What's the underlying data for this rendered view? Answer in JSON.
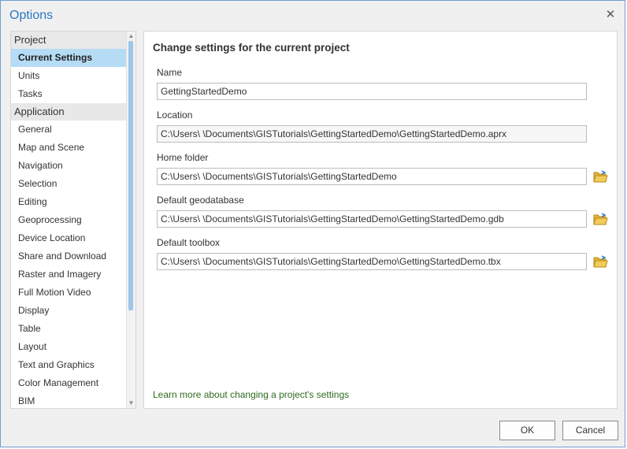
{
  "window": {
    "title": "Options",
    "close_icon": "close-icon"
  },
  "nav": {
    "groups": [
      {
        "header": "Project",
        "items": [
          "Current Settings",
          "Units",
          "Tasks"
        ]
      },
      {
        "header": "Application",
        "items": [
          "General",
          "Map and Scene",
          "Navigation",
          "Selection",
          "Editing",
          "Geoprocessing",
          "Device Location",
          "Share and Download",
          "Raster and Imagery",
          "Full Motion Video",
          "Display",
          "Table",
          "Layout",
          "Text and Graphics",
          "Color Management",
          "BIM"
        ]
      }
    ],
    "selected": "Current Settings"
  },
  "content": {
    "heading": "Change settings for the current project",
    "fields": {
      "name": {
        "label": "Name",
        "value": "GettingStartedDemo"
      },
      "location": {
        "label": "Location",
        "value": "C:\\Users\\            \\Documents\\GISTutorials\\GettingStartedDemo\\GettingStartedDemo.aprx"
      },
      "home_folder": {
        "label": "Home folder",
        "value": "C:\\Users\\            \\Documents\\GISTutorials\\GettingStartedDemo"
      },
      "default_geodatabase": {
        "label": "Default geodatabase",
        "value": "C:\\Users\\            \\Documents\\GISTutorials\\GettingStartedDemo\\GettingStartedDemo.gdb"
      },
      "default_toolbox": {
        "label": "Default toolbox",
        "value": "C:\\Users\\            \\Documents\\GISTutorials\\GettingStartedDemo\\GettingStartedDemo.tbx"
      }
    },
    "learn_more": "Learn more about changing a project's settings",
    "folder_icon": "open-folder-icon"
  },
  "footer": {
    "ok_label": "OK",
    "cancel_label": "Cancel"
  },
  "colors": {
    "accent": "#2a7ac4",
    "selection": "#b6dcf5",
    "link": "#2f6b1f",
    "folder": "#e4b43c"
  }
}
